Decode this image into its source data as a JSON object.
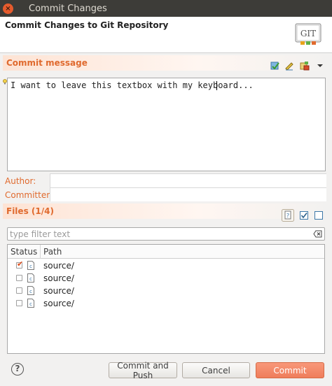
{
  "window": {
    "title": "Commit Changes",
    "close_glyph": "×"
  },
  "banner": {
    "title": "Commit Changes to Git Repository",
    "logo_text": "GIT"
  },
  "commit_message": {
    "section_label": "Commit message",
    "text": "I want to leave this textbox with my keyboard...",
    "toolbar_icons": [
      "spell-check-icon",
      "signed-off-icon",
      "add-change-id-icon",
      "menu-dropdown-icon"
    ]
  },
  "author": {
    "label": "Author:",
    "value": ""
  },
  "committer": {
    "label": "Committer:",
    "value": ""
  },
  "files": {
    "section_label": "Files (1/4)",
    "filter_placeholder": "type filter text",
    "columns": {
      "status": "Status",
      "path": "Path"
    },
    "rows": [
      {
        "checked": true,
        "path": "source/"
      },
      {
        "checked": false,
        "path": "source/"
      },
      {
        "checked": false,
        "path": "source/"
      },
      {
        "checked": false,
        "path": "source/"
      }
    ],
    "toolbar_icons": [
      "show-untracked-icon",
      "select-all-icon",
      "deselect-all-icon"
    ]
  },
  "buttons": {
    "help_glyph": "?",
    "commit_and_push": "Commit and Push",
    "cancel": "Cancel",
    "commit": "Commit"
  },
  "colors": {
    "accent": "#e06a2e",
    "primary_button": "#ef7d5b",
    "titlebar": "#3d3c38"
  }
}
